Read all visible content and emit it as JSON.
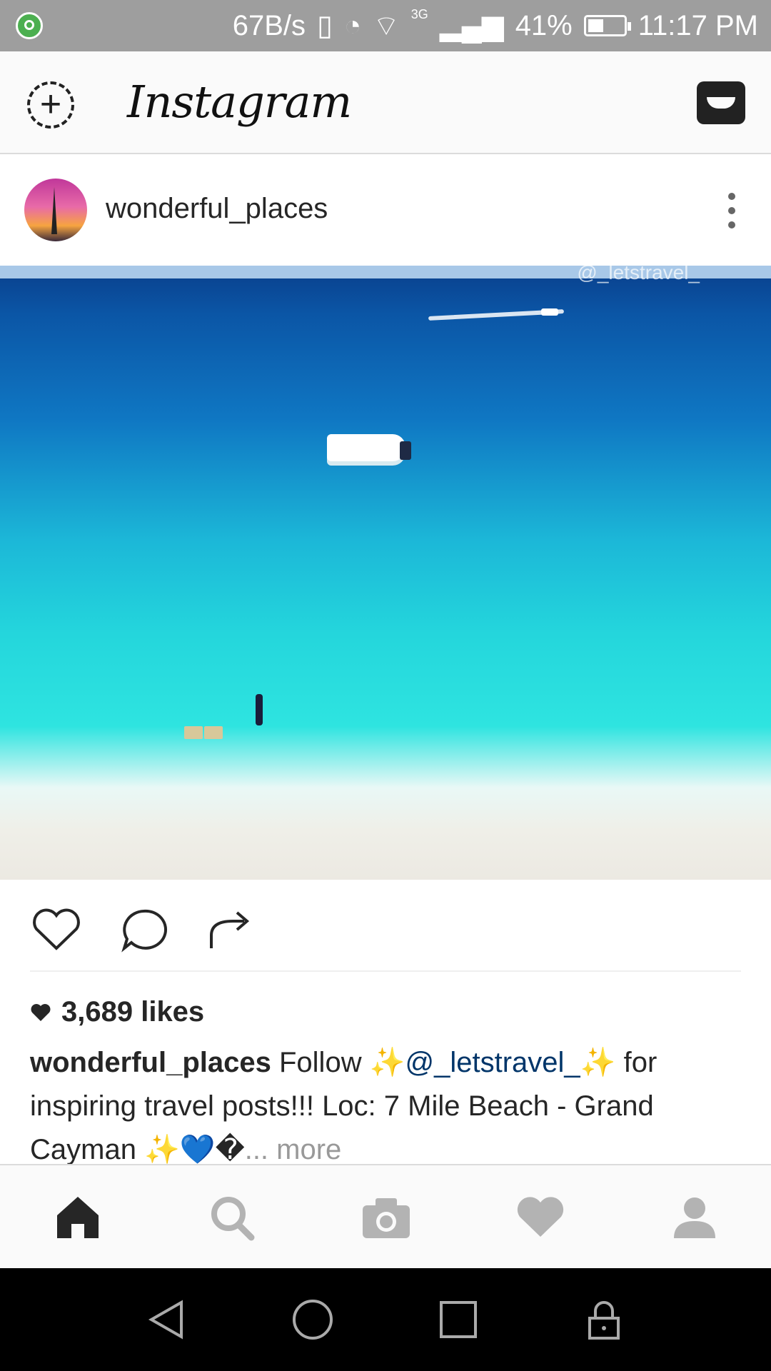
{
  "status_bar": {
    "speed": "67B/s",
    "network_type": "3G",
    "battery": "41%",
    "time": "11:17 PM"
  },
  "app_bar": {
    "brand": "Instagram"
  },
  "post": {
    "username": "wonderful_places",
    "watermark": "@_letstravel_",
    "likes": "3,689 likes",
    "caption_user": "wonderful_places",
    "caption_text_1": " Follow ",
    "caption_mention": "@_letstravel_",
    "caption_text_2": " for inspiring travel posts!!! Loc: 7 Mile Beach - Grand Cayman ",
    "emoji_sparkle": "✨",
    "emoji_blue_heart": "💙",
    "emoji_unknown": "�",
    "more": "... more"
  },
  "tabs": [
    "home",
    "search",
    "camera",
    "activity",
    "profile"
  ],
  "icons": {
    "new_story": "add-story-icon",
    "inbox": "inbox-icon",
    "like": "heart-icon",
    "comment": "comment-icon",
    "share": "share-icon"
  }
}
